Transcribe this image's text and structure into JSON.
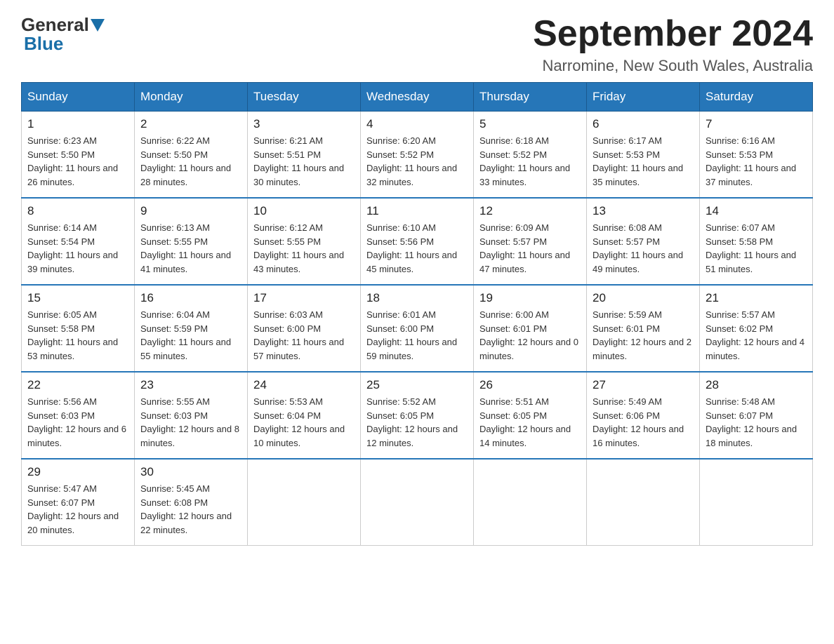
{
  "header": {
    "logo_general": "General",
    "logo_blue": "Blue",
    "month_title": "September 2024",
    "location": "Narromine, New South Wales, Australia"
  },
  "days_of_week": [
    "Sunday",
    "Monday",
    "Tuesday",
    "Wednesday",
    "Thursday",
    "Friday",
    "Saturday"
  ],
  "weeks": [
    [
      {
        "day": "1",
        "sunrise": "6:23 AM",
        "sunset": "5:50 PM",
        "daylight": "11 hours and 26 minutes."
      },
      {
        "day": "2",
        "sunrise": "6:22 AM",
        "sunset": "5:50 PM",
        "daylight": "11 hours and 28 minutes."
      },
      {
        "day": "3",
        "sunrise": "6:21 AM",
        "sunset": "5:51 PM",
        "daylight": "11 hours and 30 minutes."
      },
      {
        "day": "4",
        "sunrise": "6:20 AM",
        "sunset": "5:52 PM",
        "daylight": "11 hours and 32 minutes."
      },
      {
        "day": "5",
        "sunrise": "6:18 AM",
        "sunset": "5:52 PM",
        "daylight": "11 hours and 33 minutes."
      },
      {
        "day": "6",
        "sunrise": "6:17 AM",
        "sunset": "5:53 PM",
        "daylight": "11 hours and 35 minutes."
      },
      {
        "day": "7",
        "sunrise": "6:16 AM",
        "sunset": "5:53 PM",
        "daylight": "11 hours and 37 minutes."
      }
    ],
    [
      {
        "day": "8",
        "sunrise": "6:14 AM",
        "sunset": "5:54 PM",
        "daylight": "11 hours and 39 minutes."
      },
      {
        "day": "9",
        "sunrise": "6:13 AM",
        "sunset": "5:55 PM",
        "daylight": "11 hours and 41 minutes."
      },
      {
        "day": "10",
        "sunrise": "6:12 AM",
        "sunset": "5:55 PM",
        "daylight": "11 hours and 43 minutes."
      },
      {
        "day": "11",
        "sunrise": "6:10 AM",
        "sunset": "5:56 PM",
        "daylight": "11 hours and 45 minutes."
      },
      {
        "day": "12",
        "sunrise": "6:09 AM",
        "sunset": "5:57 PM",
        "daylight": "11 hours and 47 minutes."
      },
      {
        "day": "13",
        "sunrise": "6:08 AM",
        "sunset": "5:57 PM",
        "daylight": "11 hours and 49 minutes."
      },
      {
        "day": "14",
        "sunrise": "6:07 AM",
        "sunset": "5:58 PM",
        "daylight": "11 hours and 51 minutes."
      }
    ],
    [
      {
        "day": "15",
        "sunrise": "6:05 AM",
        "sunset": "5:58 PM",
        "daylight": "11 hours and 53 minutes."
      },
      {
        "day": "16",
        "sunrise": "6:04 AM",
        "sunset": "5:59 PM",
        "daylight": "11 hours and 55 minutes."
      },
      {
        "day": "17",
        "sunrise": "6:03 AM",
        "sunset": "6:00 PM",
        "daylight": "11 hours and 57 minutes."
      },
      {
        "day": "18",
        "sunrise": "6:01 AM",
        "sunset": "6:00 PM",
        "daylight": "11 hours and 59 minutes."
      },
      {
        "day": "19",
        "sunrise": "6:00 AM",
        "sunset": "6:01 PM",
        "daylight": "12 hours and 0 minutes."
      },
      {
        "day": "20",
        "sunrise": "5:59 AM",
        "sunset": "6:01 PM",
        "daylight": "12 hours and 2 minutes."
      },
      {
        "day": "21",
        "sunrise": "5:57 AM",
        "sunset": "6:02 PM",
        "daylight": "12 hours and 4 minutes."
      }
    ],
    [
      {
        "day": "22",
        "sunrise": "5:56 AM",
        "sunset": "6:03 PM",
        "daylight": "12 hours and 6 minutes."
      },
      {
        "day": "23",
        "sunrise": "5:55 AM",
        "sunset": "6:03 PM",
        "daylight": "12 hours and 8 minutes."
      },
      {
        "day": "24",
        "sunrise": "5:53 AM",
        "sunset": "6:04 PM",
        "daylight": "12 hours and 10 minutes."
      },
      {
        "day": "25",
        "sunrise": "5:52 AM",
        "sunset": "6:05 PM",
        "daylight": "12 hours and 12 minutes."
      },
      {
        "day": "26",
        "sunrise": "5:51 AM",
        "sunset": "6:05 PM",
        "daylight": "12 hours and 14 minutes."
      },
      {
        "day": "27",
        "sunrise": "5:49 AM",
        "sunset": "6:06 PM",
        "daylight": "12 hours and 16 minutes."
      },
      {
        "day": "28",
        "sunrise": "5:48 AM",
        "sunset": "6:07 PM",
        "daylight": "12 hours and 18 minutes."
      }
    ],
    [
      {
        "day": "29",
        "sunrise": "5:47 AM",
        "sunset": "6:07 PM",
        "daylight": "12 hours and 20 minutes."
      },
      {
        "day": "30",
        "sunrise": "5:45 AM",
        "sunset": "6:08 PM",
        "daylight": "12 hours and 22 minutes."
      },
      null,
      null,
      null,
      null,
      null
    ]
  ]
}
